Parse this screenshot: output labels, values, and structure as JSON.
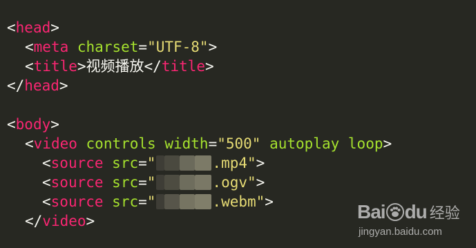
{
  "editor": {
    "theme_colors": {
      "background": "#272822",
      "punctuation": "#f8f8f2",
      "tag": "#f92672",
      "attribute": "#a6e22e",
      "string": "#e6db74"
    },
    "lines": {
      "l1": {
        "open": "<",
        "tag": "head",
        "close": ">"
      },
      "l2": {
        "open": "<",
        "tag": "meta",
        "attr": "charset",
        "eq": "=",
        "value": "\"UTF-8\"",
        "close": ">"
      },
      "l3": {
        "open": "<",
        "tag": "title",
        "close": ">",
        "text": "视频播放",
        "end_open": "</",
        "end_tag": "title",
        "end_close": ">"
      },
      "l4": {
        "open": "</",
        "tag": "head",
        "close": ">"
      },
      "l6": {
        "open": "<",
        "tag": "body",
        "close": ">"
      },
      "l7": {
        "open": "<",
        "tag": "video",
        "attr1": "controls",
        "attr2": "width",
        "eq": "=",
        "value": "\"500\"",
        "attr3": "autoplay",
        "attr4": "loop",
        "close": ">"
      },
      "l8": {
        "open": "<",
        "tag": "source",
        "attr": "src",
        "eq": "=",
        "q": "\"",
        "suffix": ".mp4\"",
        "close": ">"
      },
      "l9": {
        "open": "<",
        "tag": "source",
        "attr": "src",
        "eq": "=",
        "q": "\"",
        "suffix": ".ogv\"",
        "close": ">"
      },
      "l10": {
        "open": "<",
        "tag": "source",
        "attr": "src",
        "eq": "=",
        "q": "\"",
        "suffix": ".webm\"",
        "close": ">"
      },
      "l11": {
        "open": "</",
        "tag": "video",
        "close": ">"
      }
    }
  },
  "watermark": {
    "brand_a": "Bai",
    "brand_b": "du",
    "brand_c": "经验",
    "url": "jingyan.baidu.com"
  }
}
